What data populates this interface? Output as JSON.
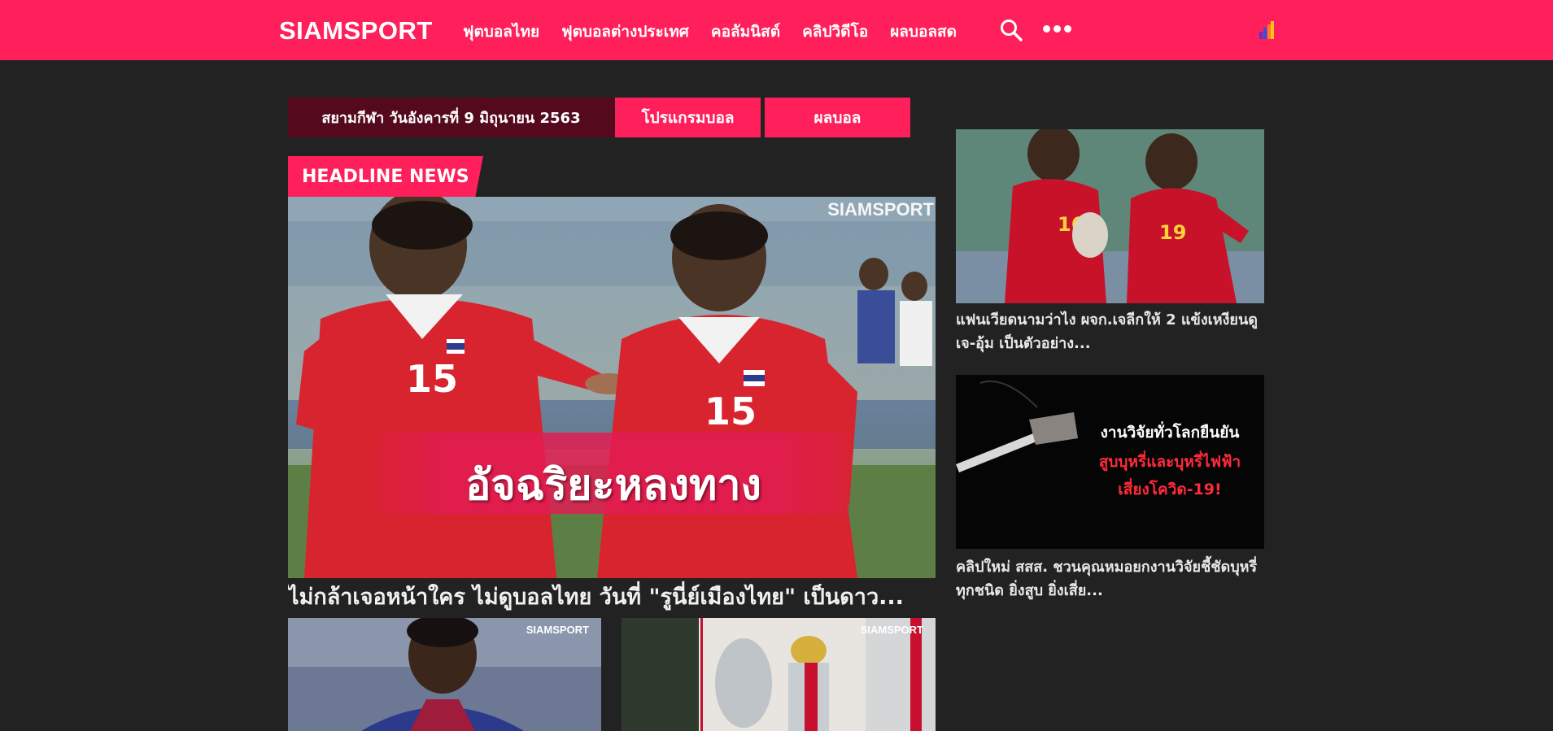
{
  "header": {
    "logo": "SIAMSPORT",
    "nav": [
      "ฟุตบอลไทย",
      "ฟุตบอลต่างประเทศ",
      "คอลัมนิสต์",
      "คลิปวิดีโอ",
      "ผลบอลสด"
    ],
    "icons": [
      "search-icon",
      "more-icon",
      "bars-icon"
    ]
  },
  "date_bar": {
    "text": "สยามกีฬา วันอังคารที่ 9 มิถุนายน 2563",
    "program_label": "โปรแกรมบอล",
    "result_label": "ผลบอล"
  },
  "headline": {
    "label": "HEADLINE NEWS",
    "image_watermark": "SIAMSPORT",
    "image_caption": "อัจฉริยะหลงทาง",
    "title": "ไม่กล้าเจอหน้าใคร ไม่ดูบอลไทย วันที่ \"รูนี่ย์เมืองไทย\" เป็นดาว..."
  },
  "bottom_thumbs": [
    {
      "watermark": "SIAMSPORT"
    },
    {
      "watermark": "SIAMSPORT"
    }
  ],
  "sidebar": {
    "items": [
      {
        "title": "แฟนเวียดนามว่าไง ผจก.เจลีกให้ 2 แข้งเหงียนดู เจ-อุ้ม เป็นตัวอย่าง..."
      },
      {
        "image_line1": "งานวิจัยทั่วโลกยืนยัน",
        "image_line2": "สูบบุหรี่และบุหรี่ไฟฟ้า",
        "image_line3": "เสี่ยงโควิด-19!",
        "title": "คลิปใหม่ สสส. ชวนคุณหมอยกงานวิจัยชี้ชัดบุหรี่ทุกชนิด ยิ่งสูบ ยิ่งเสี่ย..."
      }
    ]
  },
  "colors": {
    "brand": "#fe1f5b",
    "date_bar": "#54091c",
    "background": "#222222"
  }
}
